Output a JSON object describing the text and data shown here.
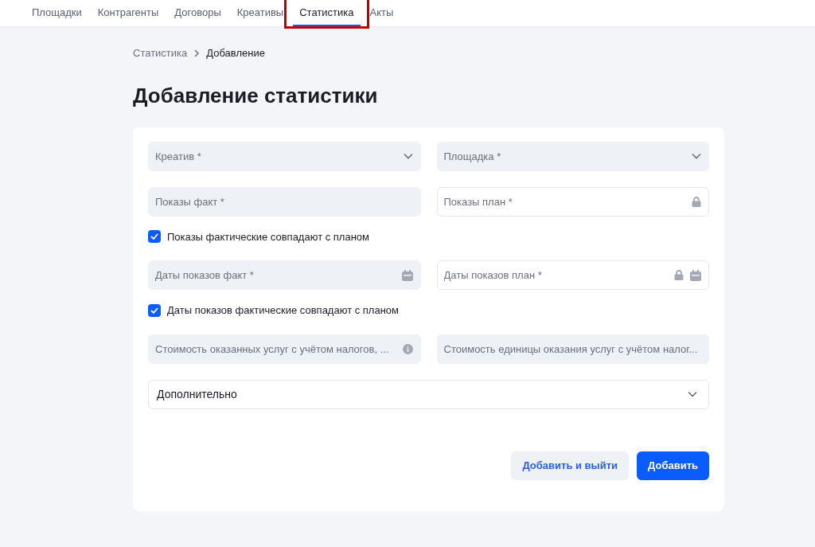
{
  "nav": {
    "tabs": [
      {
        "label": "Площадки",
        "selected": false,
        "highlighted": false
      },
      {
        "label": "Контрагенты",
        "selected": false,
        "highlighted": false
      },
      {
        "label": "Договоры",
        "selected": false,
        "highlighted": false
      },
      {
        "label": "Креативы",
        "selected": false,
        "highlighted": false
      },
      {
        "label": "Статистика",
        "selected": true,
        "highlighted": true
      },
      {
        "label": "Акты",
        "selected": false,
        "highlighted": false
      }
    ]
  },
  "breadcrumbs": [
    "Статистика",
    "Добавление"
  ],
  "title": "Добавление статистики",
  "form": {
    "rows": [
      {
        "kind": "fields",
        "fields": [
          {
            "kind": "select",
            "placeholder": "Креатив *",
            "locked": false,
            "info": false
          },
          {
            "kind": "select",
            "placeholder": "Площадка *",
            "locked": false,
            "info": false
          }
        ]
      },
      {
        "kind": "fields",
        "fields": [
          {
            "kind": "text",
            "placeholder": "Показы факт *",
            "locked": false,
            "info": false
          },
          {
            "kind": "text",
            "placeholder": "Показы план *",
            "locked": true,
            "info": false
          }
        ]
      },
      {
        "kind": "checkbox",
        "label": "Показы фактические совпадают с планом",
        "checked": true
      },
      {
        "kind": "fields",
        "fields": [
          {
            "kind": "date",
            "placeholder": "Даты показов факт *",
            "locked": false,
            "info": false
          },
          {
            "kind": "date",
            "placeholder": "Даты показов план *",
            "locked": true,
            "info": false
          }
        ]
      },
      {
        "kind": "checkbox",
        "label": "Даты показов фактические совпадают с планом",
        "checked": true
      },
      {
        "kind": "fields",
        "fields": [
          {
            "kind": "text",
            "placeholder": "Стоимость оказанных услуг с учётом налогов, ...",
            "locked": false,
            "info": true
          },
          {
            "kind": "text",
            "placeholder": "Стоимость единицы оказания услуг с учётом налог...",
            "locked": false,
            "info": false
          }
        ]
      }
    ],
    "expander": {
      "label": "Дополнительно",
      "expanded": false
    },
    "buttons": [
      {
        "kind": "secondary",
        "label": "Добавить и выйти"
      },
      {
        "kind": "primary",
        "label": "Добавить"
      }
    ]
  }
}
